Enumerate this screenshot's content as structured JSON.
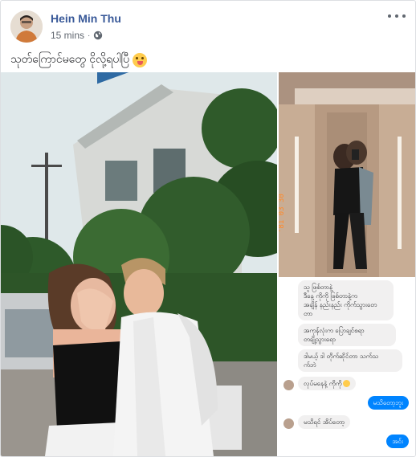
{
  "post": {
    "author": "Hein Min Thu",
    "time": "15 mins",
    "separator": "·",
    "privacy_icon": "globe-icon",
    "more_icon": "more-horizontal-icon",
    "text": "သုတ်ကြောင်မတွေ ငိုလို့ရပါပြီ",
    "emoji": "winking-face-with-tongue-emoji"
  },
  "photos": {
    "main": "couple-outdoor-photo",
    "mirror": "couple-mirror-selfie-photo",
    "chat": "messenger-chat-screenshot-photo"
  },
  "chat": {
    "messages": [
      {
        "side": "in",
        "lines": [
          "သူ ဖြစ်တာနဲ့",
          "ဒီနေ့ ကိုကို ဖြစ်တာနဲ့က",
          "အချိန် နည်းနည်း ကိုက်သွားတေ",
          "တာ"
        ]
      },
      {
        "side": "in",
        "lines": [
          "အကုန်လုံးက ပြောချင်စရာ",
          "တချို့သွားရော"
        ]
      },
      {
        "side": "in",
        "lines": [
          "ဒါမယ့် ဒါ တိုက်ဆိုင်တာ သက်သ",
          "က်ဘဲ"
        ]
      },
      {
        "side": "in",
        "lines": [
          "လုပ်မနေနဲ့ ကိုကို"
        ],
        "reaction": "smile"
      },
      {
        "side": "out",
        "lines": [
          "မသိတော့ဘူး"
        ]
      },
      {
        "side": "in",
        "lines": [
          "မသိရင် အိပ်တော့"
        ]
      },
      {
        "side": "out",
        "lines": [
          "အင်း"
        ]
      }
    ]
  },
  "colors": {
    "author": "#385898",
    "meta": "#606770",
    "text": "#1c1e21",
    "border": "#dddfe2",
    "messenger_blue": "#0084ff"
  }
}
